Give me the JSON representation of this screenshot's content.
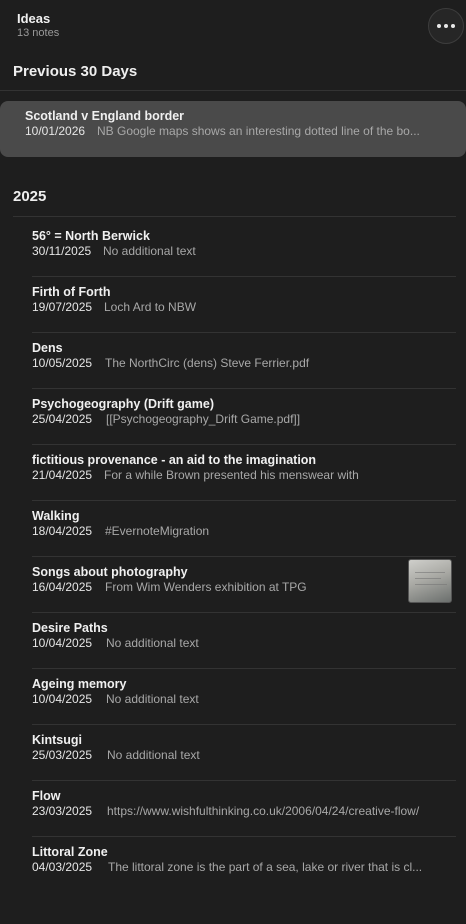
{
  "folder": {
    "title": "Ideas",
    "count": "13 notes"
  },
  "sections": {
    "recent": "Previous 30 Days",
    "year": "2025"
  },
  "selected_note": {
    "title": "Scotland v England border",
    "date": "10/01/2026",
    "snippet": "NB Google maps shows an interesting dotted line of the bo..."
  },
  "notes": [
    {
      "title": "56° = North Berwick",
      "date": "30/11/2025",
      "snippet": "No additional text"
    },
    {
      "title": "Firth of Forth",
      "date": "19/07/2025",
      "snippet": "Loch Ard to NBW"
    },
    {
      "title": "Dens",
      "date": "10/05/2025",
      "snippet": "The NorthCirc (dens) Steve Ferrier.pdf"
    },
    {
      "title": "Psychogeography (Drift game)",
      "date": "25/04/2025",
      "snippet": "[[Psychogeography_Drift Game.pdf]]"
    },
    {
      "title": "fictitious provenance - an aid to the imagination",
      "date": "21/04/2025",
      "snippet": "For a while Brown presented his menswear with"
    },
    {
      "title": "Walking",
      "date": "18/04/2025",
      "snippet": "#EvernoteMigration"
    },
    {
      "title": "Songs about photography",
      "date": "16/04/2025",
      "snippet": "From Wim Wenders exhibition at TPG"
    },
    {
      "title": "Desire Paths",
      "date": "10/04/2025",
      "snippet": "No additional text"
    },
    {
      "title": "Ageing memory",
      "date": "10/04/2025",
      "snippet": "No additional text"
    },
    {
      "title": "Kintsugi",
      "date": "25/03/2025",
      "snippet": "No additional text"
    },
    {
      "title": "Flow",
      "date": "23/03/2025",
      "snippet": "https://www.wishfulthinking.co.uk/2006/04/24/creative-flow/"
    },
    {
      "title": "Littoral Zone",
      "date": "04/03/2025",
      "snippet": "The littoral zone is the part of a sea, lake or river that is cl..."
    }
  ],
  "icons": {
    "more": "more-horizontal-icon",
    "thumbnail": "note-thumbnail-image"
  }
}
